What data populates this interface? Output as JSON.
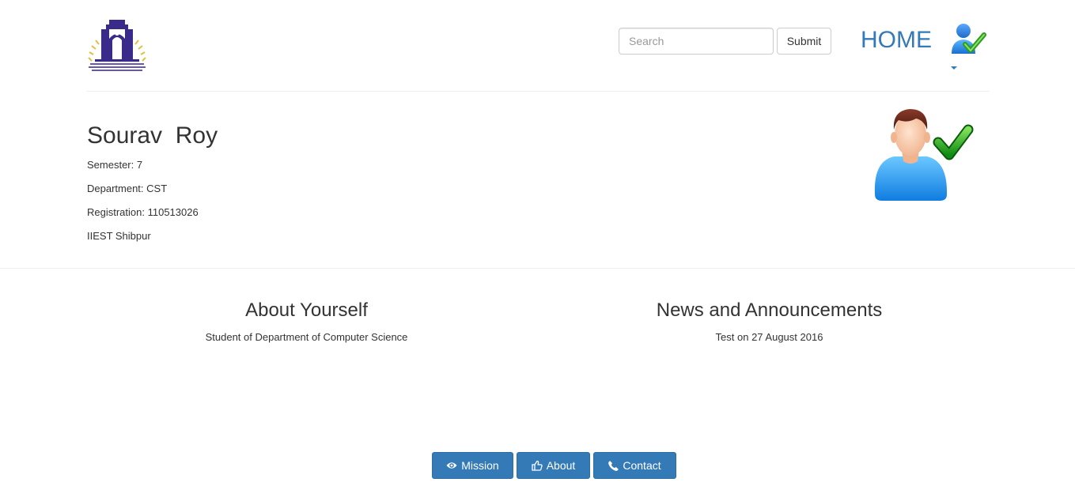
{
  "header": {
    "logo_icon": "institute-emblem",
    "search": {
      "placeholder": "Search",
      "value": ""
    },
    "submit_label": "Submit",
    "home_label": "HOME",
    "user_menu_icon": "user-check-icon"
  },
  "profile": {
    "name": "Sourav  Roy",
    "semester_label": "Semester: ",
    "semester": "7",
    "department_label": "Department: ",
    "department": "CST",
    "registration_label": "Registration: ",
    "registration": "110513026",
    "institute": "IIEST Shibpur",
    "avatar_icon": "user-verified-avatar"
  },
  "about": {
    "title": "About Yourself",
    "text": "Student of Department of Computer Science"
  },
  "news": {
    "title": "News and Announcements",
    "text": "Test on 27 August 2016"
  },
  "footer": {
    "mission_label": "Mission",
    "about_label": "About",
    "contact_label": "Contact"
  },
  "colors": {
    "primary": "#337ab7",
    "text": "#333333",
    "rule": "#eeeeee",
    "check_green": "#2e9e1f"
  }
}
